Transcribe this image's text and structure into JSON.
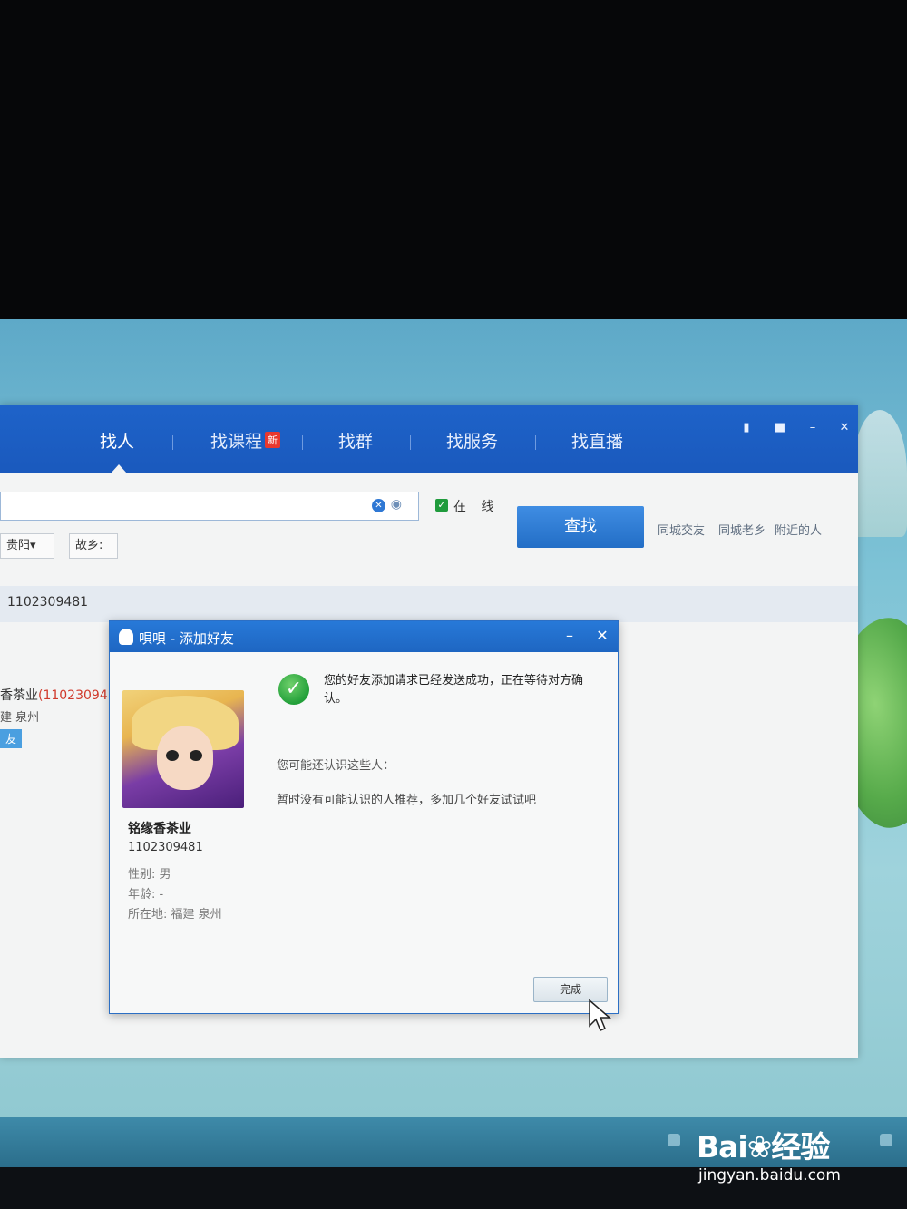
{
  "find_window": {
    "tabs": [
      {
        "label": "找人"
      },
      {
        "label": "找课程",
        "badge": "新"
      },
      {
        "label": "找群"
      },
      {
        "label": "找服务"
      },
      {
        "label": "找直播"
      }
    ],
    "online_label": "在 线",
    "search_button": "查找",
    "side_links": [
      "同城交友",
      "同城老乡",
      "附近的人"
    ],
    "filters": [
      "贵阳▾",
      "故乡:"
    ],
    "result": {
      "id_row": "1102309481",
      "name_partial": "香茶业",
      "id_partial": "(11023094",
      "loc_partial": "建 泉州",
      "add_partial": "友"
    }
  },
  "dialog": {
    "title": "唄唄 - 添加好友",
    "user": {
      "name": "铭缘香茶业",
      "id": "1102309481",
      "gender": "性别: 男",
      "age": "年龄: -",
      "location": "所在地: 福建 泉州"
    },
    "success_message": "您的好友添加请求已经发送成功，正在等待对方确认。",
    "maybe_know": "您可能还认识这些人：",
    "no_recommendation": "暂时没有可能认识的人推荐，多加几个好友试试吧",
    "done_button": "完成"
  },
  "watermark": {
    "logo": "Bai❀经验",
    "url": "jingyan.baidu.com"
  },
  "colors": {
    "header_blue": "#1e63c9",
    "success_green": "#23a03a",
    "id_red": "#d0392b"
  }
}
